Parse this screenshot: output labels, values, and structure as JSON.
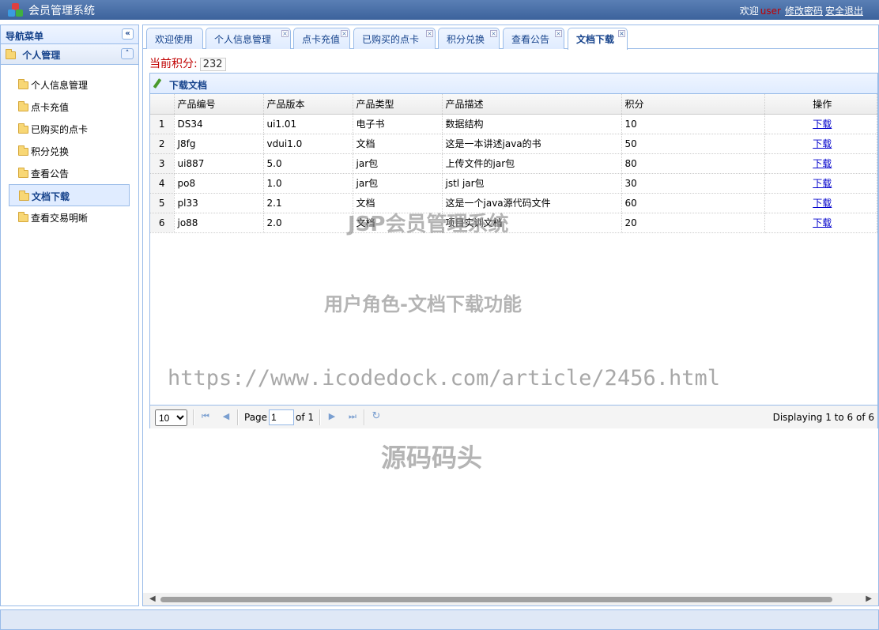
{
  "header": {
    "title": "会员管理系统",
    "welcome": "欢迎",
    "username": "user",
    "change_password": "修改密码",
    "logout": "安全退出"
  },
  "sidebar": {
    "title": "导航菜单",
    "collapse_icon": "«",
    "section": "个人管理",
    "section_toggle": "˄",
    "items": [
      {
        "label": "个人信息管理"
      },
      {
        "label": "点卡充值"
      },
      {
        "label": "已购买的点卡"
      },
      {
        "label": "积分兑换"
      },
      {
        "label": "查看公告"
      },
      {
        "label": "文档下载",
        "active": true
      },
      {
        "label": "查看交易明晰"
      }
    ]
  },
  "tabs": [
    {
      "label": "欢迎使用",
      "closable": false
    },
    {
      "label": "个人信息管理",
      "closable": true
    },
    {
      "label": "点卡充值",
      "closable": true
    },
    {
      "label": "已购买的点卡",
      "closable": true
    },
    {
      "label": "积分兑换",
      "closable": true
    },
    {
      "label": "查看公告",
      "closable": true
    },
    {
      "label": "文档下载",
      "closable": true,
      "active": true
    }
  ],
  "points": {
    "label": "当前积分:",
    "value": "232"
  },
  "panel": {
    "title": "下载文档"
  },
  "table": {
    "columns": [
      "产品编号",
      "产品版本",
      "产品类型",
      "产品描述",
      "积分",
      "操作"
    ],
    "rows": [
      {
        "n": "1",
        "id": "DS34",
        "version": "ui1.01",
        "type": "电子书",
        "desc": "数据结构",
        "points": "10",
        "action": "下载"
      },
      {
        "n": "2",
        "id": "J8fg",
        "version": "vdui1.0",
        "type": "文档",
        "desc": "这是一本讲述java的书",
        "points": "50",
        "action": "下载"
      },
      {
        "n": "3",
        "id": "ui887",
        "version": "5.0",
        "type": "jar包",
        "desc": "上传文件的jar包",
        "points": "80",
        "action": "下载"
      },
      {
        "n": "4",
        "id": "po8",
        "version": "1.0",
        "type": "jar包",
        "desc": "jstl jar包",
        "points": "30",
        "action": "下载"
      },
      {
        "n": "5",
        "id": "pl33",
        "version": "2.1",
        "type": "文档",
        "desc": "这是一个java源代码文件",
        "points": "60",
        "action": "下载"
      },
      {
        "n": "6",
        "id": "jo88",
        "version": "2.0",
        "type": "文档",
        "desc": "项目实训文档",
        "points": "20",
        "action": "下载"
      }
    ]
  },
  "pager": {
    "page_size": "10",
    "page_label": "Page",
    "page_value": "1",
    "of_label": "of 1",
    "display": "Displaying 1 to 6 of 6"
  },
  "watermarks": {
    "w1": "JSP会员管理系统",
    "w2": "用户角色-文档下载功能",
    "w3": "https://www.icodedock.com/article/2456.html",
    "w4": "源码码头"
  },
  "colors": {
    "header": "#3c629c",
    "accent": "#15428b",
    "border": "#99bbe8",
    "points": "#c00000"
  }
}
